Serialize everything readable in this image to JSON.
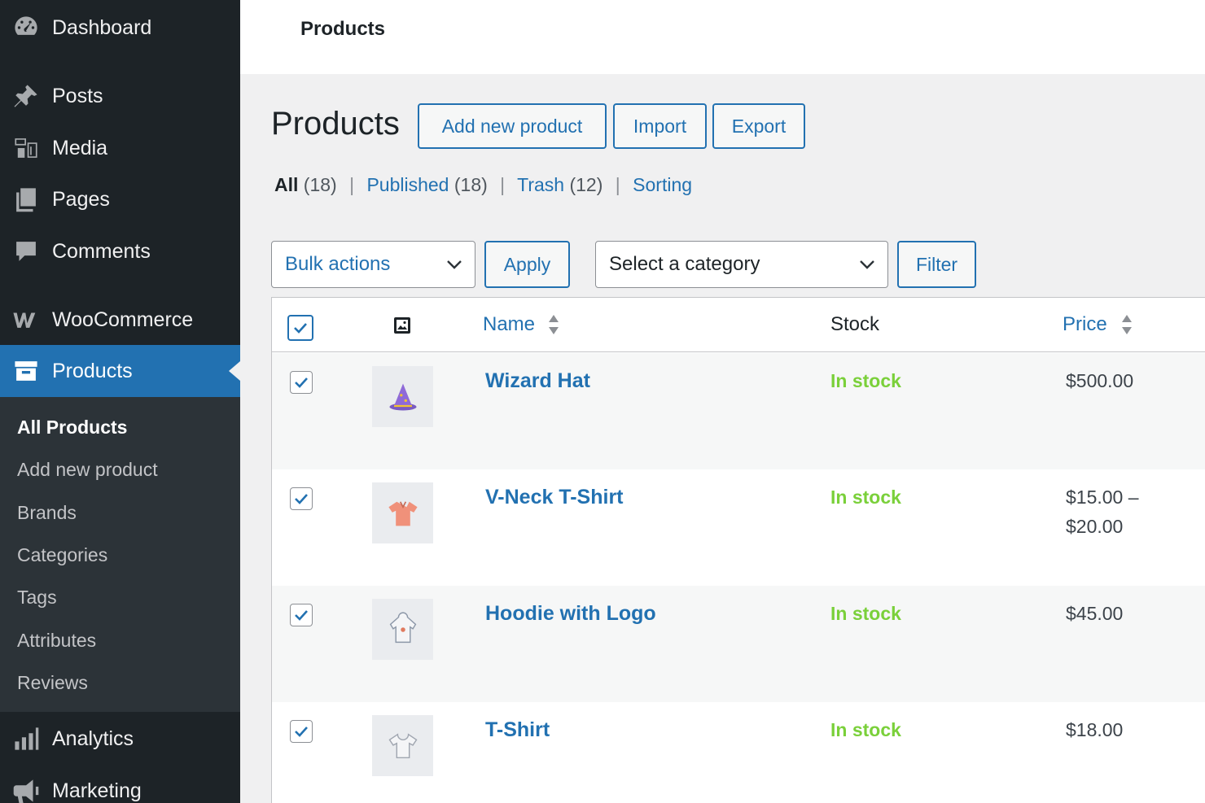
{
  "sidebar": {
    "items": [
      {
        "label": "Dashboard",
        "icon": "dashboard-icon"
      },
      {
        "label": "Posts",
        "icon": "pushpin-icon"
      },
      {
        "label": "Media",
        "icon": "media-icon"
      },
      {
        "label": "Pages",
        "icon": "pages-icon"
      },
      {
        "label": "Comments",
        "icon": "comment-icon"
      },
      {
        "label": "WooCommerce",
        "icon": "woocommerce-icon"
      },
      {
        "label": "Products",
        "icon": "archive-box-icon"
      },
      {
        "label": "Analytics",
        "icon": "bar-chart-icon"
      },
      {
        "label": "Marketing",
        "icon": "megaphone-icon"
      }
    ],
    "submenu": [
      "All Products",
      "Add new product",
      "Brands",
      "Categories",
      "Tags",
      "Attributes",
      "Reviews"
    ]
  },
  "topbar": {
    "title": "Products"
  },
  "header": {
    "title": "Products",
    "add_new": "Add new product",
    "import": "Import",
    "export": "Export"
  },
  "views": {
    "all": "All",
    "all_count": "(18)",
    "published": "Published",
    "published_count": "(18)",
    "trash": "Trash",
    "trash_count": "(12)",
    "sorting": "Sorting",
    "separator": "|"
  },
  "filters": {
    "bulk_actions": "Bulk actions",
    "apply": "Apply",
    "category": "Select a category",
    "filter": "Filter"
  },
  "table": {
    "columns": {
      "name": "Name",
      "stock": "Stock",
      "price": "Price"
    },
    "rows": [
      {
        "name": "Wizard Hat",
        "stock": "In stock",
        "price": "$500.00",
        "thumb": "wizard-hat-icon",
        "checked": true
      },
      {
        "name": "V-Neck T-Shirt",
        "stock": "In stock",
        "price": "$15.00 – $20.00",
        "thumb": "vneck-tshirt-icon",
        "checked": true
      },
      {
        "name": "Hoodie with Logo",
        "stock": "In stock",
        "price": "$45.00",
        "thumb": "hoodie-icon",
        "checked": true
      },
      {
        "name": "T-Shirt",
        "stock": "In stock",
        "price": "$18.00",
        "thumb": "tshirt-icon",
        "checked": true
      }
    ]
  },
  "colors": {
    "accent": "#2271b1",
    "sidebar": "#1d2327",
    "in_stock": "#7ad03a"
  }
}
